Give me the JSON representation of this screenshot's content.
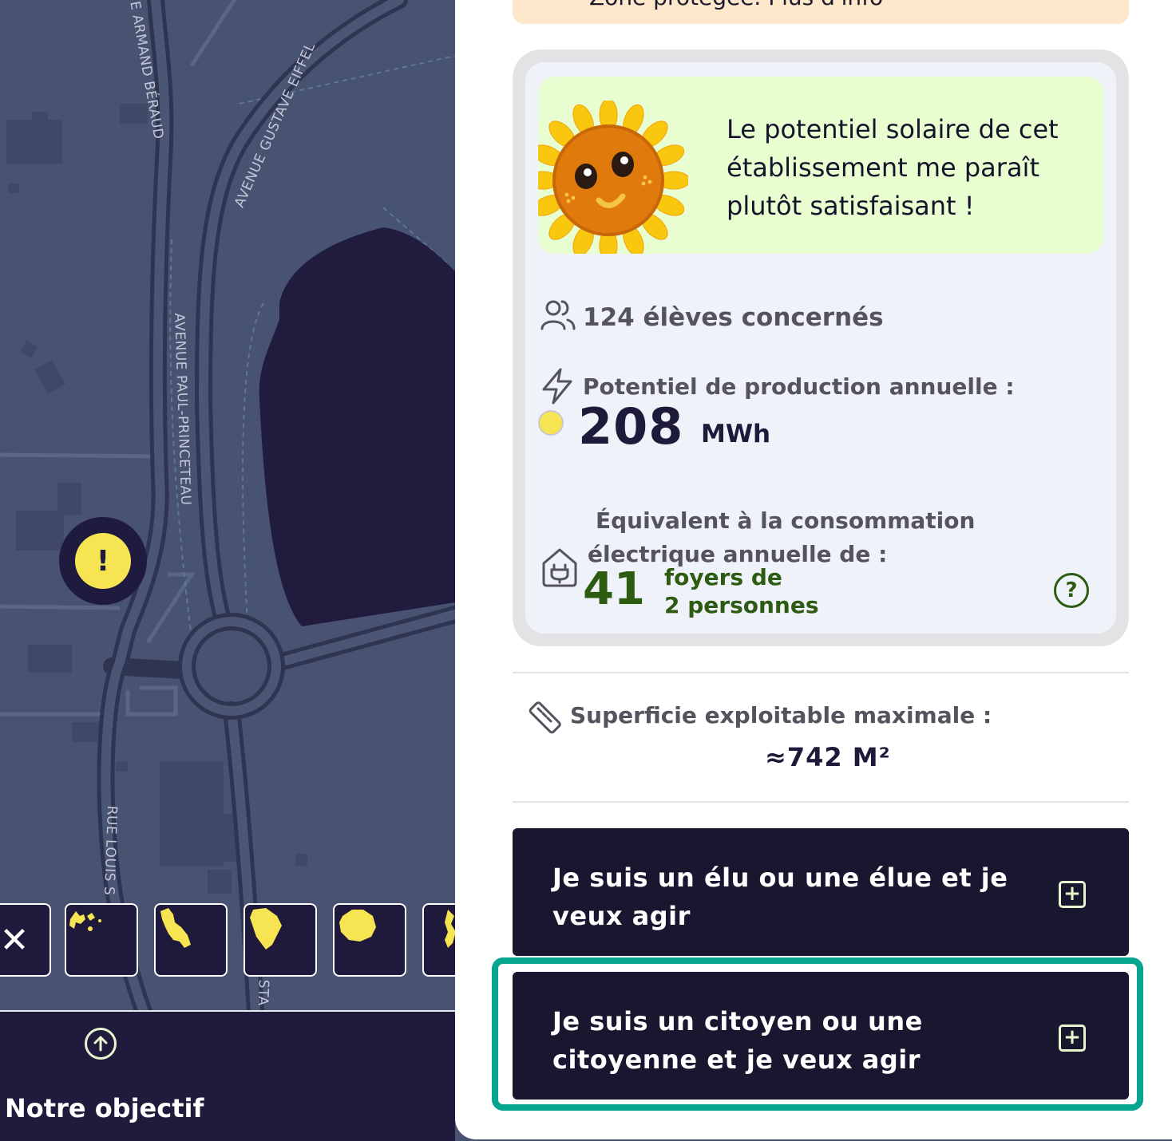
{
  "map": {
    "streets": [
      "E ARMAND BÉRAUD",
      "AVENUE GUSTAVE EIFFEL",
      "AVENUE PAUL-PRINCETEAU",
      "RUE LOUIS S",
      "STA"
    ],
    "marker_icon": "warning-icon",
    "marker_symbol": "!"
  },
  "territories": {
    "close_symbol": "✕",
    "items": [
      "guadeloupe",
      "martinique",
      "guyane",
      "la-reunion",
      "mayotte"
    ]
  },
  "bottom_bar": {
    "up_icon": "arrow-up-circle-icon",
    "goal_label": "Notre objectif"
  },
  "banner": {
    "text": "Zone protégée. Plus d'info"
  },
  "card": {
    "mascot_icon": "sunflower-mascot",
    "speech": "Le potentiel solaire de cet établissement me paraît plutôt satisfaisant !",
    "students": "124 élèves concernés",
    "production_label": "Potentiel de production annuelle :",
    "production_value": "208",
    "production_unit": "MWh",
    "equivalent_label": "Équivalent à la consommation électrique annuelle de :",
    "households_value": "41",
    "households_line1": "foyers de",
    "households_line2": "2 personnes",
    "help_symbol": "?"
  },
  "surface": {
    "label": "Superficie exploitable maximale :",
    "value": "≈742 M²"
  },
  "actions": [
    {
      "label": "Je suis un élu ou une élue et je veux agir",
      "icon": "plus-square-icon"
    },
    {
      "label": "Je suis un citoyen ou une citoyenne et je veux agir",
      "icon": "plus-square-icon"
    }
  ],
  "colors": {
    "map_bg": "#485271",
    "building": "#211c3e",
    "marker": "#f6e452",
    "accent_green": "#2e5b12",
    "focus": "#06a58f",
    "button_bg": "#191730"
  }
}
